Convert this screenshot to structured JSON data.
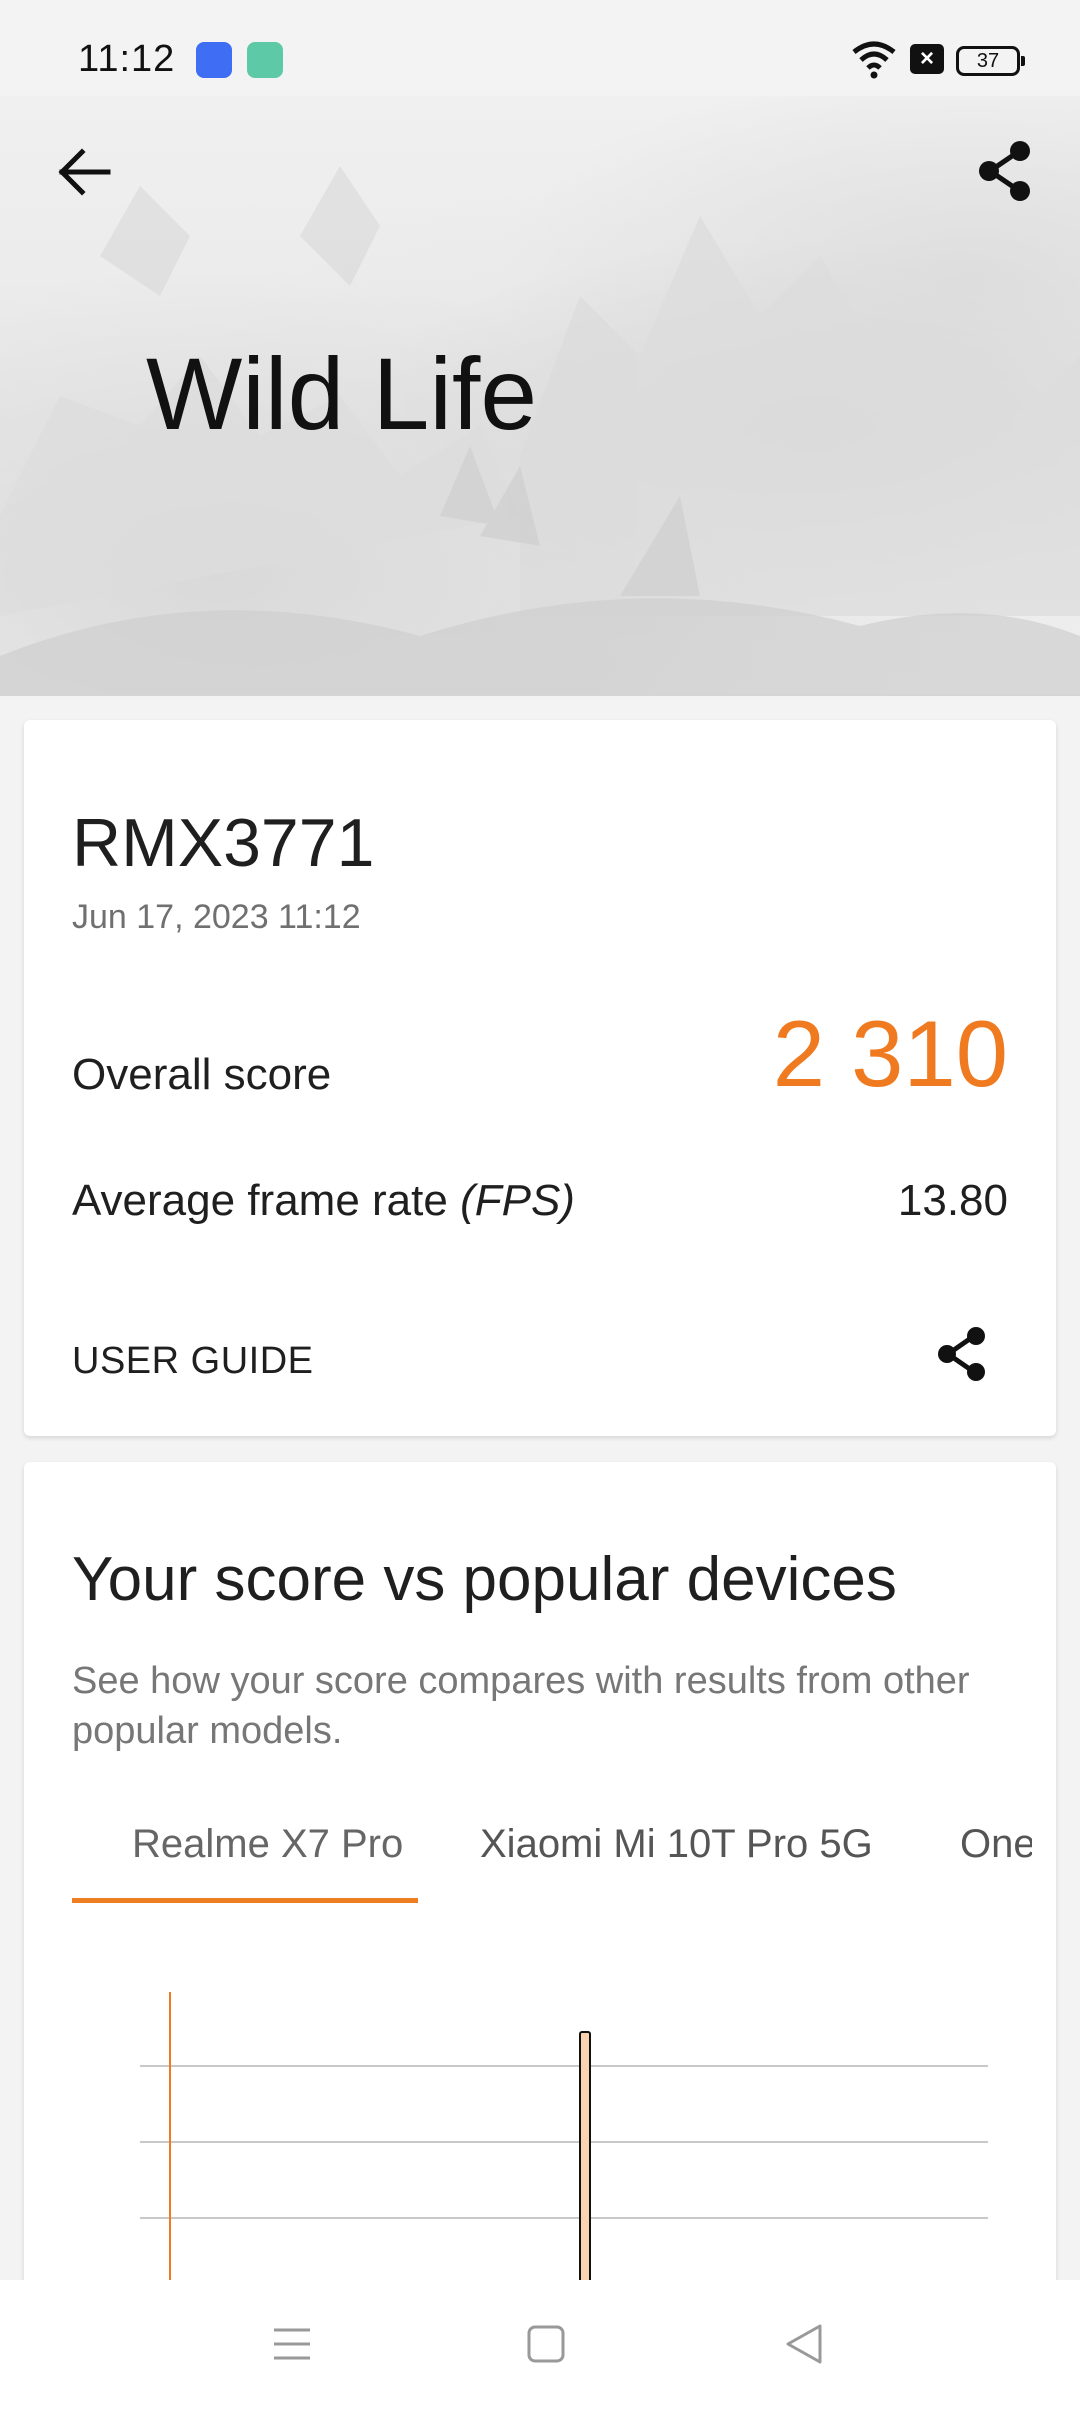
{
  "status_bar": {
    "time": "11:12",
    "battery": "37",
    "icons": [
      "hotspot-app-icon",
      "app-icon",
      "wifi-icon",
      "no-sim-icon",
      "battery-icon"
    ]
  },
  "hero": {
    "title": "Wild Life",
    "back_icon": "arrow-left-icon",
    "share_icon": "share-icon"
  },
  "result": {
    "device": "RMX3771",
    "date": "Jun 17, 2023 11:12",
    "overall_label": "Overall score",
    "overall_value": "2 310",
    "fps_label_main": "Average frame rate ",
    "fps_label_unit": "(FPS)",
    "fps_value": "13.80",
    "user_guide": "USER GUIDE"
  },
  "compare": {
    "title": "Your score vs popular devices",
    "subtitle": "See how your score compares with results from other popular models.",
    "tabs": [
      "Realme X7 Pro",
      "Xiaomi Mi 10T Pro 5G",
      "One"
    ],
    "selected_tab": 0
  },
  "colors": {
    "accent": "#f07a20",
    "bar_fill": "#fcd3b0",
    "gridline": "#c8c8c8"
  },
  "chart_data": {
    "type": "bar",
    "title": "",
    "xlabel": "",
    "ylabel": "",
    "categories": [
      "Realme X7 Pro",
      "RMX3771"
    ],
    "values": [
      null,
      2310
    ],
    "grid": true
  }
}
